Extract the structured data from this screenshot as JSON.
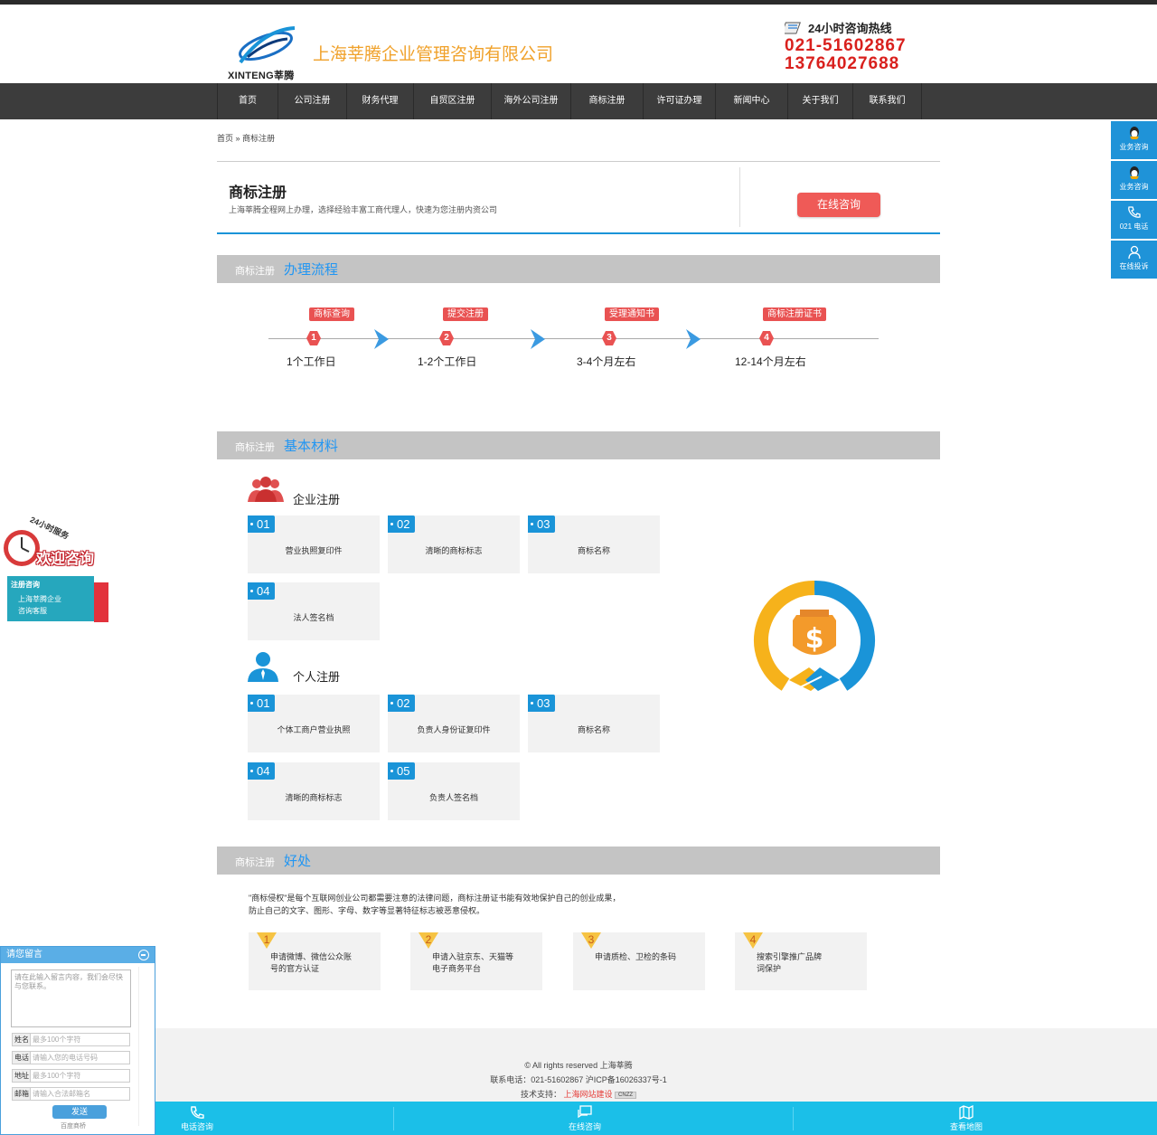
{
  "header": {
    "logo_text": "XINTENG莘腾",
    "company_name": "上海莘腾企业管理咨询有限公司",
    "hotline_title": "24小时咨询热线",
    "hotline_1": "021-51602867",
    "hotline_2": "13764027688"
  },
  "nav": {
    "items": [
      "首页",
      "公司注册",
      "财务代理",
      "自贸区注册",
      "海外公司注册",
      "商标注册",
      "许可证办理",
      "新闻中心",
      "关于我们",
      "联系我们"
    ]
  },
  "breadcrumb": {
    "home": "首页",
    "sep": "»",
    "current": "商标注册"
  },
  "hero": {
    "title": "商标注册",
    "desc": "上海莘腾全程网上办理，选择经验丰富工商代理人，快速为您注册内资公司",
    "button": "在线咨询"
  },
  "sections": {
    "process": {
      "prefix": "商标注册",
      "title": "办理流程"
    },
    "materials": {
      "prefix": "商标注册",
      "title": "基本材料"
    },
    "benefits": {
      "prefix": "商标注册",
      "title": "好处"
    }
  },
  "process_steps": [
    {
      "tag": "商标查询",
      "num": "1",
      "time": "1个工作日"
    },
    {
      "tag": "提交注册",
      "num": "2",
      "time": "1-2个工作日"
    },
    {
      "tag": "受理通知书",
      "num": "3",
      "time": "3-4个月左右"
    },
    {
      "tag": "商标注册证书",
      "num": "4",
      "time": "12-14个月左右"
    }
  ],
  "enterprise": {
    "title": "企业注册",
    "cards": [
      {
        "num": "01",
        "text": "营业执照复印件"
      },
      {
        "num": "02",
        "text": "清晰的商标标志"
      },
      {
        "num": "03",
        "text": "商标名称"
      },
      {
        "num": "04",
        "text": "法人签名档"
      }
    ]
  },
  "personal": {
    "title": "个人注册",
    "cards": [
      {
        "num": "01",
        "text": "个体工商户营业执照"
      },
      {
        "num": "02",
        "text": "负责人身份证复印件"
      },
      {
        "num": "03",
        "text": "商标名称"
      },
      {
        "num": "04",
        "text": "清晰的商标标志"
      },
      {
        "num": "05",
        "text": "负责人签名档"
      }
    ]
  },
  "benefits": {
    "intro_1": "\"商标侵权\"是每个互联网创业公司都需要注意的法律问题，商标注册证书能有效地保护自己的创业成果，",
    "intro_2": "防止自己的文字、图形、字母、数字等显著特征标志被恶意侵权。",
    "cards": [
      {
        "num": "1",
        "line1": "申请微博、微信公众账",
        "line2": "号的官方认证"
      },
      {
        "num": "2",
        "line1": "申请入驻京东、天猫等",
        "line2": "电子商务平台"
      },
      {
        "num": "3",
        "line1": "申请质检、卫检的条码",
        "line2": ""
      },
      {
        "num": "4",
        "line1": "搜索引擎推广品牌",
        "line2": "词保护"
      }
    ]
  },
  "footer": {
    "copyright": "© All rights reserved 上海莘腾",
    "contact": "联系电话：021-51602867 沪ICP备16026337号-1",
    "support_label": "技术支持：",
    "support_link": "上海网站建设",
    "badge": "CNZZ"
  },
  "bottom_bar": {
    "phone": "电话咨询",
    "online": "在线咨询",
    "map": "查看地图"
  },
  "side_panel": [
    "业务咨询",
    "业务咨询",
    "021 电话",
    "在线投诉"
  ],
  "left_float": {
    "service": "24小时服务",
    "welcome": "欢迎咨询",
    "title": "注册咨询",
    "link1": "上海莘腾企业",
    "link2": "咨询客服"
  },
  "message_box": {
    "title": "请您留言",
    "placeholder": "请在此输入留言内容，我们会尽快与您联系。",
    "fields": [
      {
        "label": "姓名",
        "placeholder": "最多100个字符"
      },
      {
        "label": "电话",
        "placeholder": "请输入您的电话号码"
      },
      {
        "label": "地址",
        "placeholder": "最多100个字符"
      },
      {
        "label": "邮箱",
        "placeholder": "请输入合法邮箱名"
      }
    ],
    "send": "发送",
    "powered": "百度商桥"
  },
  "colors": {
    "accent_blue": "#1a94d8",
    "accent_red": "#e95252",
    "nav_bg": "#3c3c3c",
    "hotline_red": "#d9201d",
    "company_orange": "#f0a12a"
  }
}
